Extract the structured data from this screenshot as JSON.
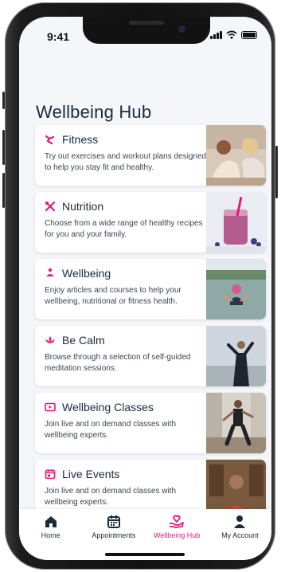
{
  "status": {
    "time": "9:41"
  },
  "page": {
    "title": "Wellbeing Hub"
  },
  "colors": {
    "accent": "#e5197a",
    "text": "#1c2b3a"
  },
  "cards": [
    {
      "icon": "fitness-icon",
      "title": "Fitness",
      "description": "Try out exercises and workout plans designed to help you stay fit and healthy."
    },
    {
      "icon": "nutrition-icon",
      "title": "Nutrition",
      "description": "Choose from a wide range of healthy recipes for you and your family."
    },
    {
      "icon": "wellbeing-icon",
      "title": "Wellbeing",
      "description": "Enjoy articles and courses to help your wellbeing, nutritional or fitness health."
    },
    {
      "icon": "lotus-icon",
      "title": "Be Calm",
      "description": "Browse through a selection of self-guided meditation sessions."
    },
    {
      "icon": "video-play-icon",
      "title": "Wellbeing Classes",
      "description": "Join live and on demand classes with wellbeing experts."
    },
    {
      "icon": "calendar-icon",
      "title": "Live Events",
      "description": "Join live and on demand classes with wellbeing experts."
    }
  ],
  "tabs": [
    {
      "label": "Home",
      "icon": "home-icon",
      "active": false
    },
    {
      "label": "Appointments",
      "icon": "calendar-icon",
      "active": false
    },
    {
      "label": "Wellbeing Hub",
      "icon": "heart-hand-icon",
      "active": true
    },
    {
      "label": "My Account",
      "icon": "person-icon",
      "active": false
    }
  ]
}
